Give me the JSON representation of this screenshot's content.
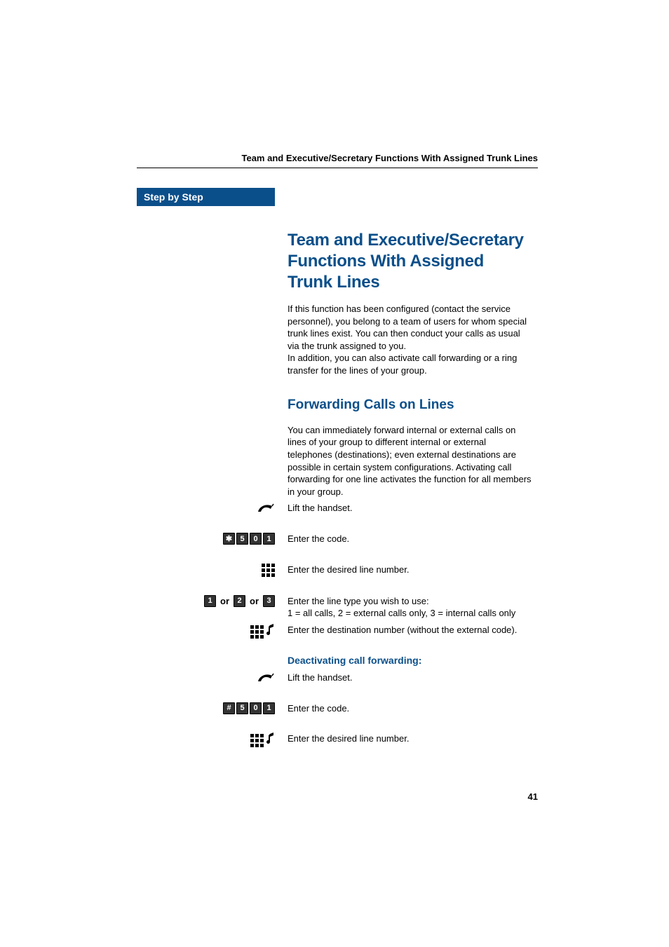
{
  "running_header": "Team and Executive/Secretary Functions With Assigned Trunk Lines",
  "sidebar_badge": "Step by Step",
  "h1": "Team and Executive/Secretary Functions With Assigned Trunk Lines",
  "intro_p1": "If this function has been configured (contact the service personnel), you belong to a team of users for whom special trunk lines exist. You can then conduct your calls as usual via the trunk assigned to you.",
  "intro_p2": "In addition, you can also activate call forwarding or a ring transfer for the lines of your group.",
  "h2": "Forwarding Calls on Lines",
  "fwd_p1": "You can immediately forward internal or external calls on lines of your group to different internal or external telephones (destinations); even external destinations are possible in certain system configurations. Activating call forwarding for one line activates the function for all members in your group.",
  "steps": {
    "lift1": "Lift the handset.",
    "code1_keys": [
      "✱",
      "5",
      "0",
      "1"
    ],
    "code1_text": "Enter the code.",
    "line_num_text": "Enter the desired line number.",
    "type_keys": {
      "opts": [
        "1",
        "2",
        "3"
      ],
      "or": "or"
    },
    "type_line1": "Enter the line type you wish to use:",
    "type_line2": "1 = all calls, 2 = external calls only, 3 = internal calls only",
    "dest_text": "Enter the destination number (without the external code).",
    "deact_h3": "Deactivating call forwarding:",
    "lift2": "Lift the handset.",
    "code2_keys": [
      "#",
      "5",
      "0",
      "1"
    ],
    "code2_text": "Enter the code.",
    "line_num_text2": "Enter the desired line number."
  },
  "page_number": "41"
}
